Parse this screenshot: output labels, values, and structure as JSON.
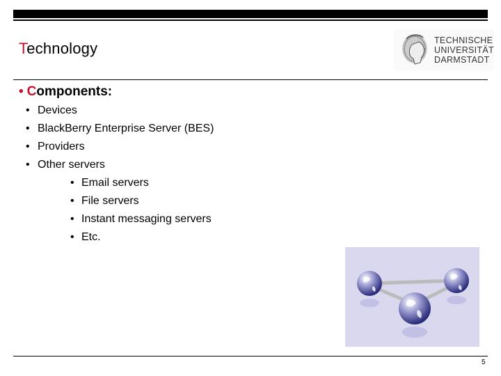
{
  "header": {
    "title_first_letter": "T",
    "title_rest": "echnology",
    "logo": {
      "icon": "tu-darmstadt-athena-head-icon",
      "lines": [
        "TECHNISCHE",
        "UNIVERSITÄT",
        "DARMSTADT"
      ]
    }
  },
  "content": {
    "heading_bullet": "•",
    "heading_first_letter": "C",
    "heading_rest": "omponents:",
    "bullet": "•",
    "items": [
      {
        "label": "Devices"
      },
      {
        "label": "BlackBerry Enterprise Server (BES)"
      },
      {
        "label": "Providers"
      },
      {
        "label": "Other servers",
        "children": [
          {
            "label": "Email servers"
          },
          {
            "label": "File servers"
          },
          {
            "label": "Instant messaging servers"
          },
          {
            "label": "Etc."
          }
        ]
      }
    ]
  },
  "image": {
    "description": "network-of-globes-illustration",
    "accent_color": "#3a3a8c",
    "background_color": "#d9d8ef"
  },
  "footer": {
    "page_number": "5"
  },
  "colors": {
    "accent_red": "#c8102e",
    "text": "#000000"
  }
}
